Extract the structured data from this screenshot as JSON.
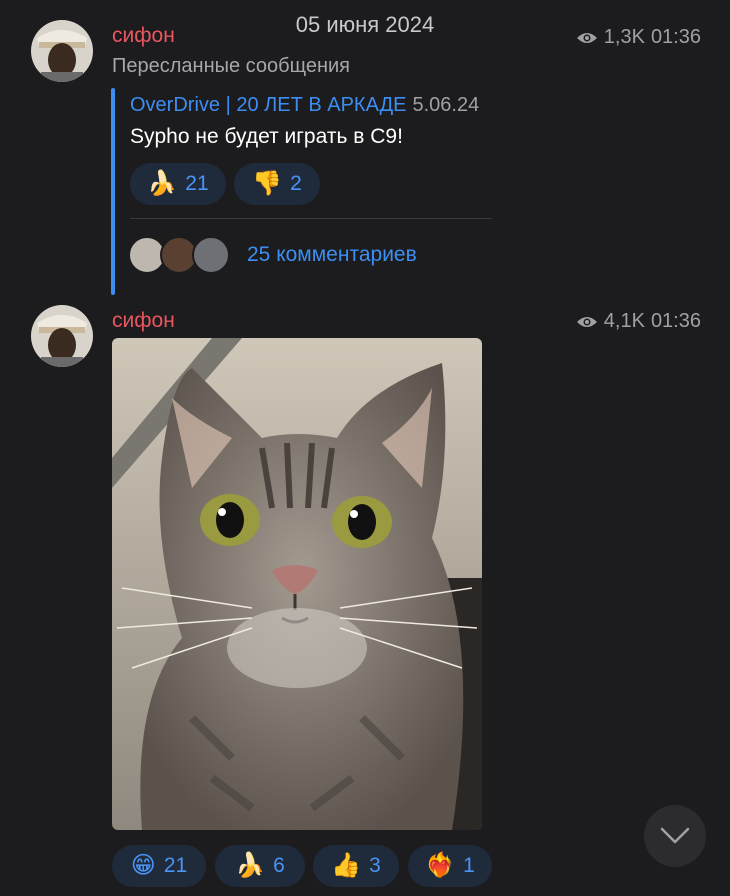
{
  "date_header": "05 июня 2024",
  "messages": [
    {
      "author": "сифон",
      "views": "1,3K",
      "time": "01:36",
      "forward_label": "Пересланные сообщения",
      "quote": {
        "source": "OverDrive | 20 ЛЕТ В АРКАДЕ",
        "date": "5.06.24",
        "text": "Sypho не будет играть в C9!",
        "reactions": [
          {
            "emoji": "🍌",
            "count": "21"
          },
          {
            "emoji": "👎",
            "count": "2"
          }
        ],
        "comments_label": "25 комментариев"
      }
    },
    {
      "author": "сифон",
      "views": "4,1K",
      "time": "01:36",
      "photo_icon": "cat-photo",
      "reactions": [
        {
          "emoji": "😁",
          "count": "21"
        },
        {
          "emoji": "🍌",
          "count": "6"
        },
        {
          "emoji": "👍",
          "count": "3"
        },
        {
          "emoji": "❤️‍🔥",
          "count": "1"
        }
      ]
    }
  ],
  "icons": {
    "views": "eye-icon",
    "scroll": "chevron-down-icon"
  },
  "colors": {
    "background": "#1c1c1e",
    "author": "#e8565f",
    "accent": "#3d8ef2",
    "reaction_bg": "#1f2a3b"
  }
}
